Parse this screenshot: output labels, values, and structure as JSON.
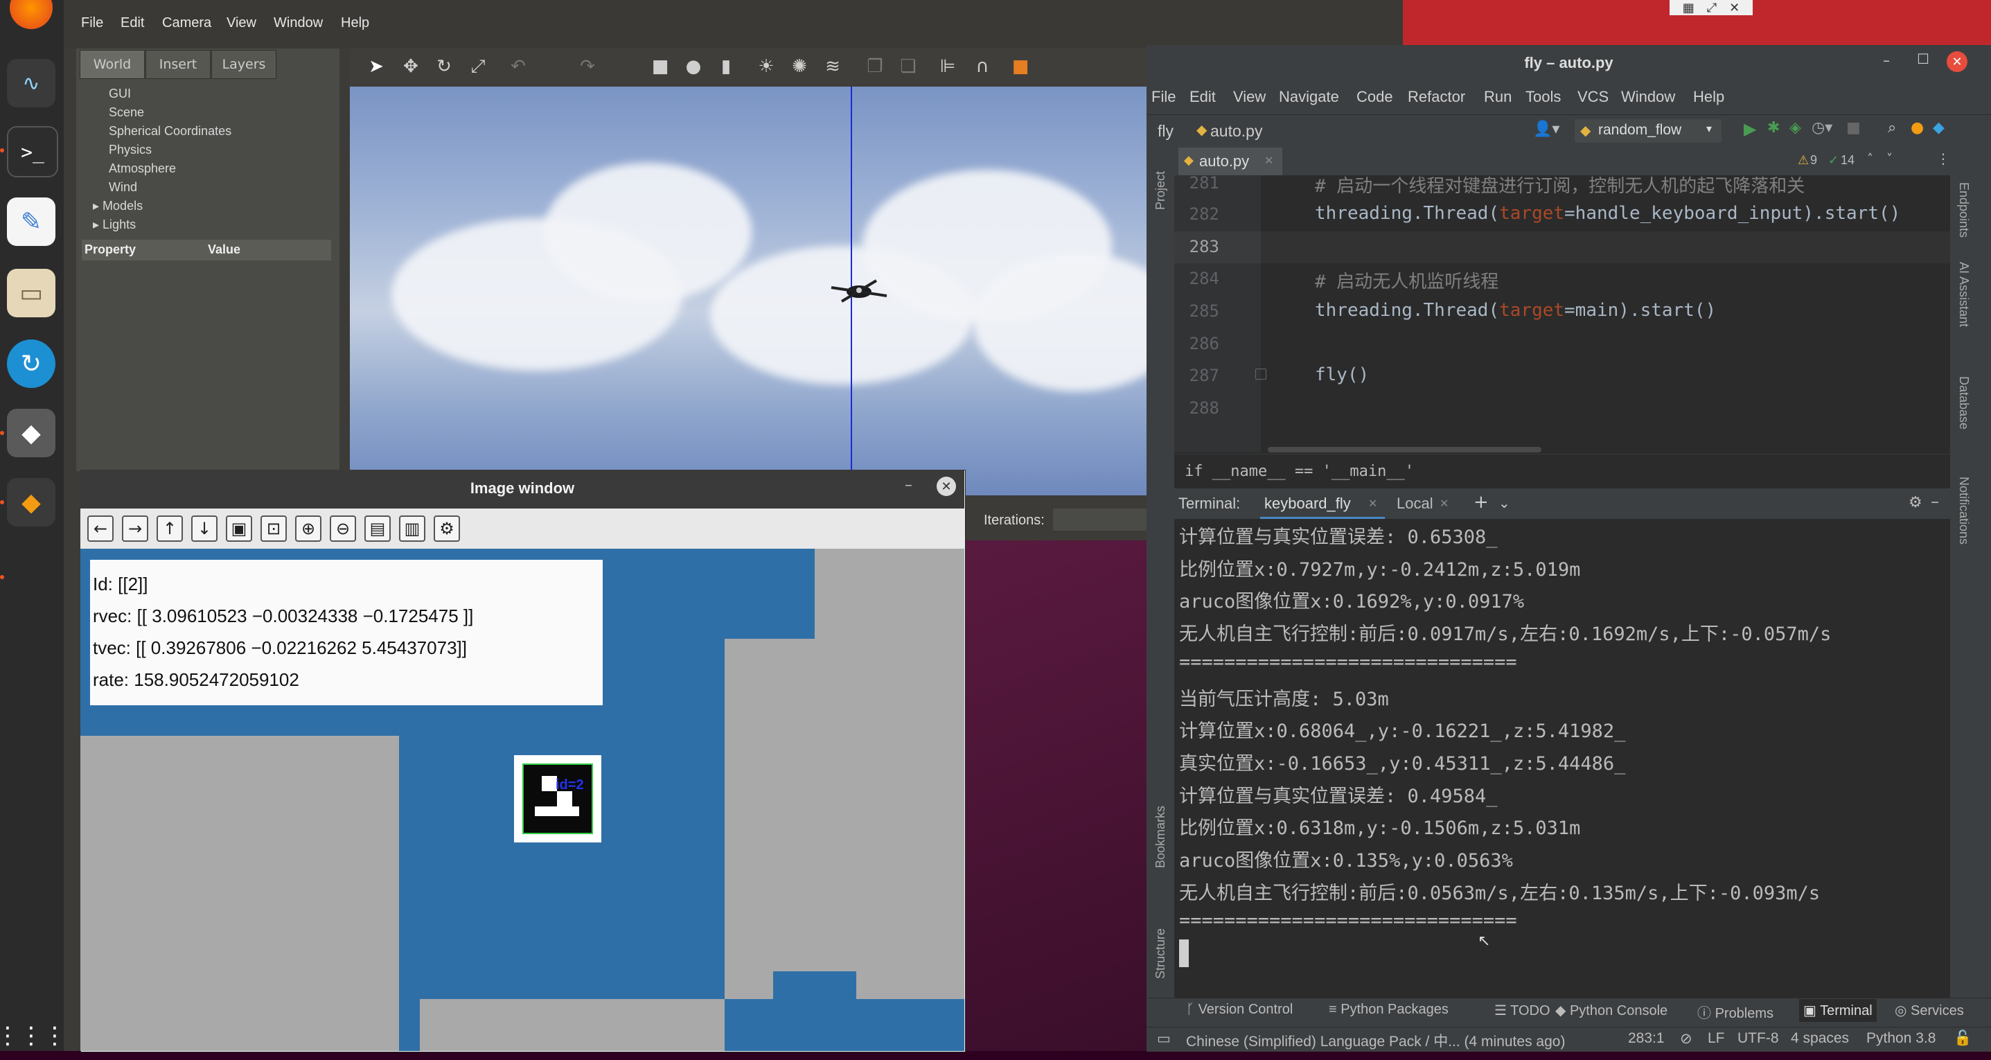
{
  "gazebo": {
    "menu": [
      "File",
      "Edit",
      "Camera",
      "View",
      "Window",
      "Help"
    ],
    "tabs": [
      "World",
      "Insert",
      "Layers"
    ],
    "tree": [
      "GUI",
      "Scene",
      "Spherical Coordinates",
      "Physics",
      "Atmosphere",
      "Wind",
      "Models",
      "Lights"
    ],
    "prop_header": {
      "property": "Property",
      "value": "Value"
    },
    "iterations_label": "Iterations:"
  },
  "image_window": {
    "title": "Image window",
    "info": {
      "id": "Id:  [[2]]",
      "rvec": "rvec:  [[  3.09610523  −0.00324338  −0.1725475  ]]",
      "tvec": "tvec:  [[  0.39267806  −0.02216262   5.45437073]]",
      "rate": "rate:  158.9052472059102"
    },
    "marker_label": "id=2"
  },
  "ide": {
    "title": "fly – auto.py",
    "menu": [
      "File",
      "Edit",
      "View",
      "Navigate",
      "Code",
      "Refactor",
      "Run",
      "Tools",
      "VCS",
      "Window",
      "Help"
    ],
    "project": "fly",
    "file": "auto.py",
    "run_config": "random_flow",
    "warnings": "9",
    "checks": "14",
    "tab": "auto.py",
    "lines": [
      {
        "n": "281",
        "text": "# 启动一个线程对键盘进行订阅，控制无人机的起飞降落和关"
      },
      {
        "n": "282",
        "text": "threading.Thread(target=handle_keyboard_input).start()"
      },
      {
        "n": "283",
        "text": ""
      },
      {
        "n": "284",
        "text": "# 启动无人机监听线程"
      },
      {
        "n": "285",
        "text": "threading.Thread(target=main).start()"
      },
      {
        "n": "286",
        "text": ""
      },
      {
        "n": "287",
        "text": "fly()"
      },
      {
        "n": "288",
        "text": ""
      }
    ],
    "breadcrumb": "if __name__ == '__main__'",
    "terminal": {
      "label": "Terminal:",
      "tab1": "keyboard_fly",
      "tab2": "Local",
      "lines": [
        "计算位置与真实位置误差: 0.65308_",
        "比例位置x:0.7927m,y:-0.2412m,z:5.019m",
        "aruco图像位置x:0.1692%,y:0.0917%",
        "无人机自主飞行控制:前后:0.0917m/s,左右:0.1692m/s,上下:-0.057m/s",
        "==============================",
        "当前气压计高度: 5.03m",
        "计算位置x:0.68064_,y:-0.16221_,z:5.41982_",
        "真实位置x:-0.16653_,y:0.45311_,z:5.44486_",
        "计算位置与真实位置误差: 0.49584_",
        "比例位置x:0.6318m,y:-0.1506m,z:5.031m",
        "aruco图像位置x:0.135%,y:0.0563%",
        "无人机自主飞行控制:前后:0.0563m/s,左右:0.135m/s,上下:-0.093m/s",
        "=============================="
      ]
    },
    "toolwindows": [
      "Version Control",
      "Python Packages",
      "TODO",
      "Python Console",
      "Problems",
      "Terminal",
      "Services"
    ],
    "status": {
      "message": "Chinese (Simplified) Language Pack / 中... (4 minutes ago)",
      "position": "283:1",
      "line_sep": "LF",
      "encoding": "UTF-8",
      "indent": "4 spaces",
      "interpreter": "Python 3.8"
    },
    "side_left": [
      "Project",
      "Bookmarks",
      "Structure"
    ],
    "side_right": [
      "Endpoints",
      "AI Assistant",
      "Database",
      "Notifications"
    ]
  }
}
